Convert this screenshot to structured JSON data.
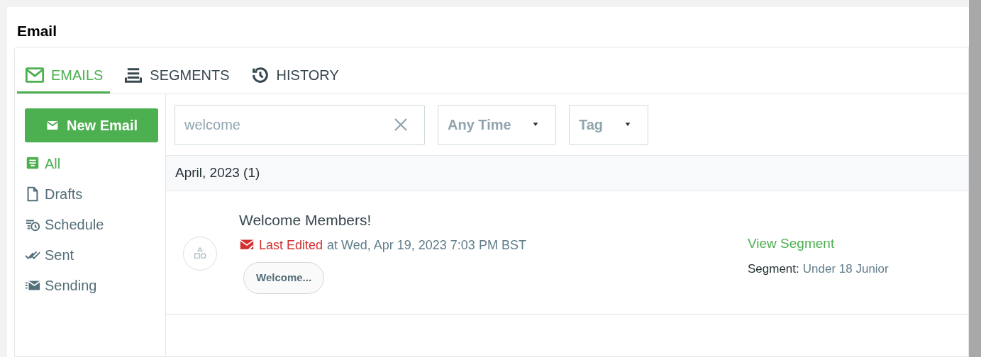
{
  "page": {
    "title": "Email"
  },
  "tabs": [
    {
      "label": "EMAILS",
      "kind": "mail",
      "selected": true
    },
    {
      "label": "SEGMENTS",
      "kind": "list",
      "selected": false
    },
    {
      "label": "HISTORY",
      "kind": "history",
      "selected": false
    }
  ],
  "sidebar": {
    "new_button": "New Email",
    "items": [
      {
        "label": "All",
        "kind": "all",
        "selected": true
      },
      {
        "label": "Drafts",
        "kind": "drafts",
        "selected": false
      },
      {
        "label": "Schedule",
        "kind": "schedule",
        "selected": false
      },
      {
        "label": "Sent",
        "kind": "sent",
        "selected": false
      },
      {
        "label": "Sending",
        "kind": "sending",
        "selected": false
      }
    ]
  },
  "filters": {
    "search": {
      "value": "welcome"
    },
    "dropdowns": [
      "Any Time",
      "Tag"
    ]
  },
  "groups": [
    {
      "heading": "April, 2023 (1)",
      "emails": [
        {
          "title": "Welcome Members!",
          "status": "Last Edited",
          "timestamp": "at Wed, Apr 19, 2023 7:03 PM BST",
          "tag": "Welcome...",
          "link": "View Segment",
          "segment_label": "Segment:",
          "segment": "Under 18 Junior"
        }
      ]
    }
  ]
}
